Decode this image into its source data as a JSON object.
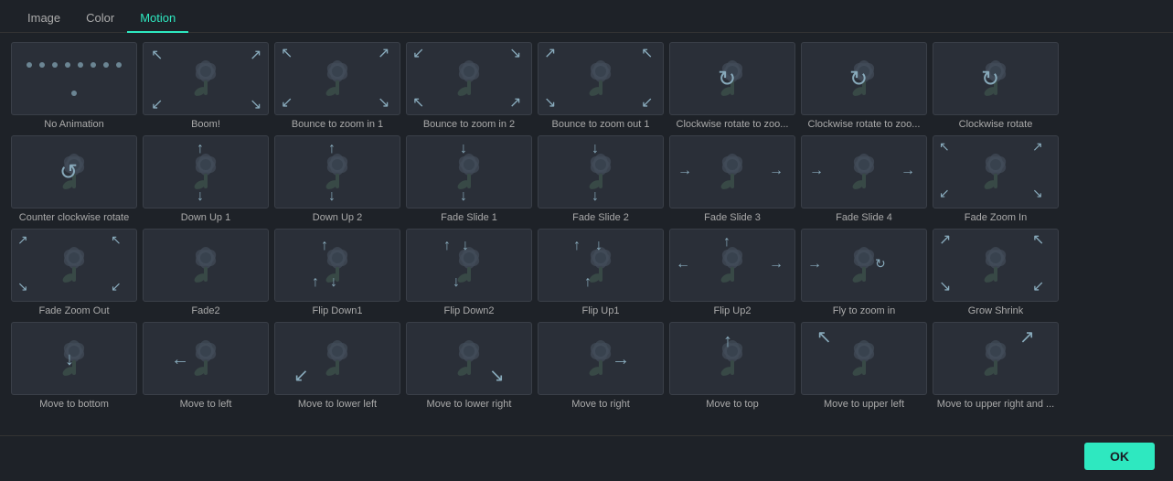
{
  "tabs": [
    {
      "label": "Image",
      "id": "image",
      "active": false
    },
    {
      "label": "Color",
      "id": "color",
      "active": false
    },
    {
      "label": "Motion",
      "id": "motion",
      "active": true
    }
  ],
  "animations": [
    {
      "id": "no-animation",
      "label": "No Animation",
      "arrows": "dots"
    },
    {
      "id": "boom",
      "label": "Boom!",
      "arrows": "zoom-out-corners"
    },
    {
      "id": "bounce-zoom-in-1",
      "label": "Bounce to zoom in 1",
      "arrows": "corners-in"
    },
    {
      "id": "bounce-zoom-in-2",
      "label": "Bounce to zoom in 2",
      "arrows": "corners-in-2"
    },
    {
      "id": "bounce-zoom-out-1",
      "label": "Bounce to zoom out 1",
      "arrows": "corners-out"
    },
    {
      "id": "cw-rotate-zoo-1",
      "label": "Clockwise rotate to zoo...",
      "arrows": "cw-rotate"
    },
    {
      "id": "cw-rotate-zoo-2",
      "label": "Clockwise rotate to zoo...",
      "arrows": "cw-rotate"
    },
    {
      "id": "cw-rotate",
      "label": "Clockwise rotate",
      "arrows": "cw-rotate-simple"
    },
    {
      "id": "ccw-rotate",
      "label": "Counter clockwise rotate",
      "arrows": "ccw-rotate"
    },
    {
      "id": "down-up-1",
      "label": "Down Up 1",
      "arrows": "down-up"
    },
    {
      "id": "down-up-2",
      "label": "Down Up 2",
      "arrows": "down-up"
    },
    {
      "id": "fade-slide-1",
      "label": "Fade Slide 1",
      "arrows": "down"
    },
    {
      "id": "fade-slide-2",
      "label": "Fade Slide 2",
      "arrows": "down"
    },
    {
      "id": "fade-slide-3",
      "label": "Fade Slide 3",
      "arrows": "right"
    },
    {
      "id": "fade-slide-4",
      "label": "Fade Slide 4",
      "arrows": "right"
    },
    {
      "id": "fade-zoom-in",
      "label": "Fade Zoom In",
      "arrows": "corners-out-tl-br"
    },
    {
      "id": "fade-zoom-out",
      "label": "Fade Zoom Out",
      "arrows": "corners-in-tl-br"
    },
    {
      "id": "fade2",
      "label": "Fade2",
      "arrows": "none"
    },
    {
      "id": "flip-down1",
      "label": "Flip Down1",
      "arrows": "up-down-arrows"
    },
    {
      "id": "flip-down2",
      "label": "Flip Down2",
      "arrows": "up-down-arrows2"
    },
    {
      "id": "flip-up1",
      "label": "Flip Up1",
      "arrows": "up-down-arrows3"
    },
    {
      "id": "flip-up2",
      "label": "Flip Up2",
      "arrows": "left-up-right"
    },
    {
      "id": "fly-zoom-in",
      "label": "Fly to zoom in",
      "arrows": "fly-in"
    },
    {
      "id": "grow-shrink",
      "label": "Grow Shrink",
      "arrows": "corners-all"
    },
    {
      "id": "move-bottom",
      "label": "Move to bottom",
      "arrows": "arrow-down"
    },
    {
      "id": "move-left",
      "label": "Move to left",
      "arrows": "arrow-left"
    },
    {
      "id": "move-lower-left",
      "label": "Move to lower left",
      "arrows": "arrow-lower-left"
    },
    {
      "id": "move-lower-right",
      "label": "Move to lower right",
      "arrows": "arrow-lower-right"
    },
    {
      "id": "move-right",
      "label": "Move to right",
      "arrows": "arrow-right"
    },
    {
      "id": "move-top",
      "label": "Move to top",
      "arrows": "arrow-up"
    },
    {
      "id": "move-upper-left",
      "label": "Move to upper left",
      "arrows": "arrow-upper-left"
    },
    {
      "id": "move-upper-right",
      "label": "Move to upper right and ...",
      "arrows": "arrow-upper-right"
    }
  ],
  "ok_label": "OK"
}
